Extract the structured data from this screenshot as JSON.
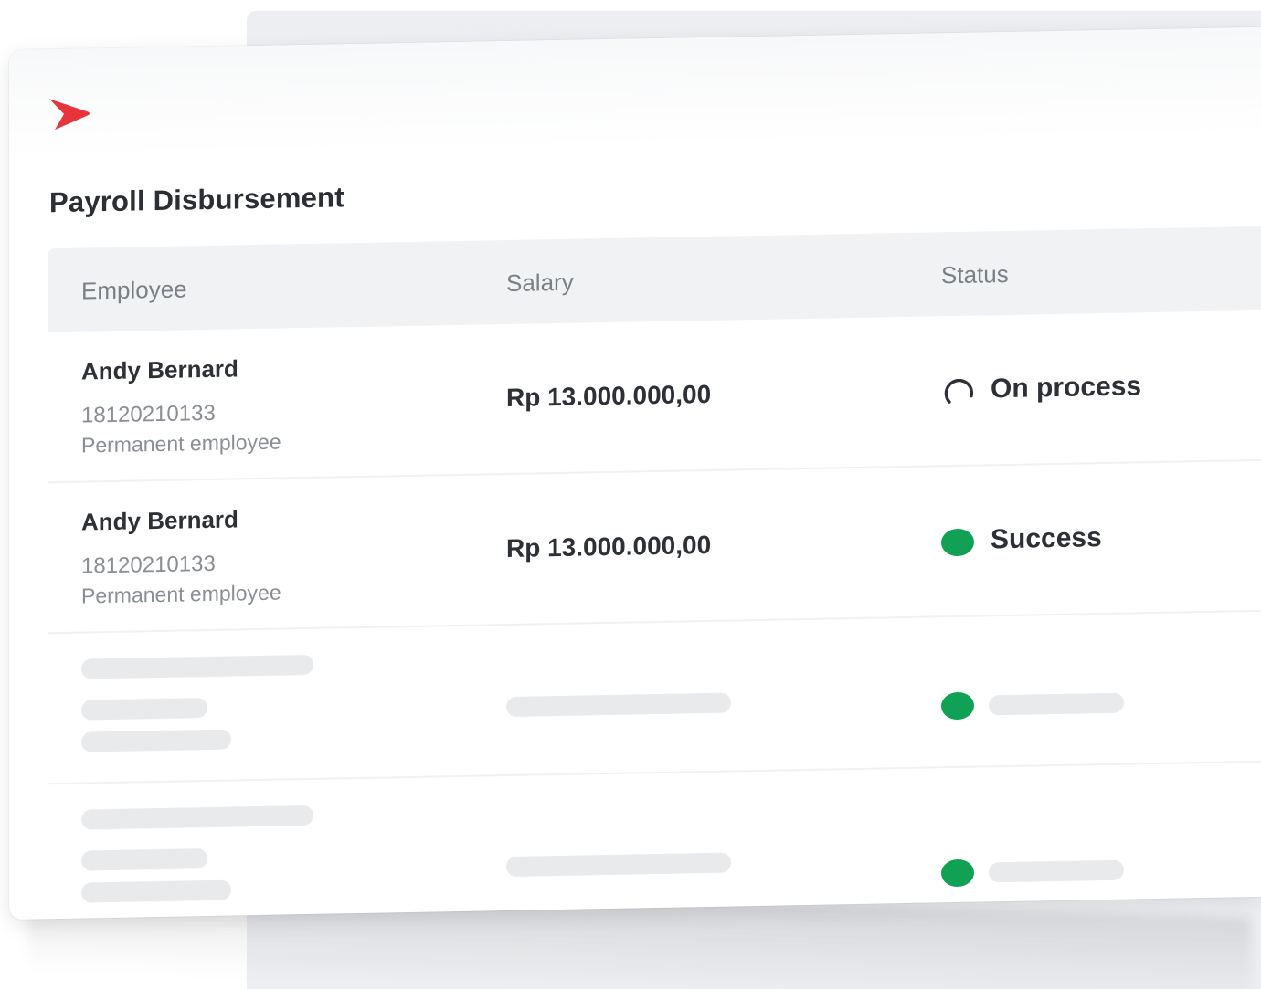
{
  "page": {
    "title": "Payroll Disbursement"
  },
  "brand": {
    "logo_icon": "chevron-right-logo-icon",
    "accent_color": "#e8353b"
  },
  "table": {
    "columns": [
      "Employee",
      "Salary",
      "Status"
    ],
    "rows": [
      {
        "name": "Andy Bernard",
        "id": "18120210133",
        "type": "Permanent employee",
        "salary": "Rp 13.000.000,00",
        "status": "On process",
        "status_icon": "spinner-icon"
      },
      {
        "name": "Andy Bernard",
        "id": "18120210133",
        "type": "Permanent employee",
        "salary": "Rp 13.000.000,00",
        "status": "Success",
        "status_icon": "success-dot-icon"
      }
    ]
  },
  "colors": {
    "success": "#10a155",
    "text_primary": "#2d3136",
    "text_secondary": "#8a8f95",
    "header_bg": "#f1f2f4",
    "skeleton": "#e9eaec"
  }
}
